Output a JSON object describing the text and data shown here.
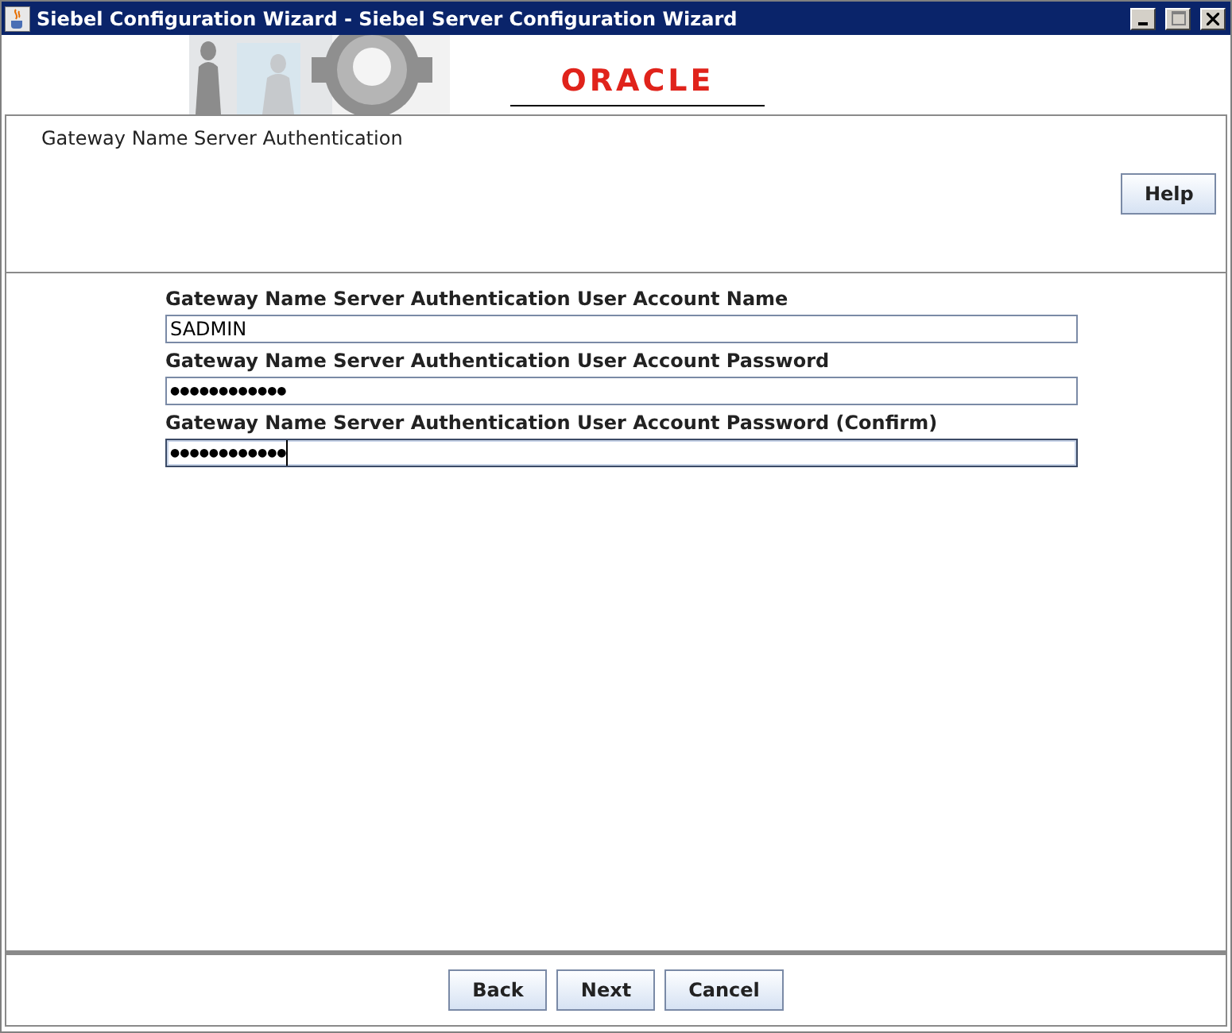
{
  "window": {
    "title": "Siebel Configuration Wizard - Siebel Server Configuration Wizard"
  },
  "banner": {
    "logo": "ORACLE",
    "kind": "picture"
  },
  "header": {
    "title": "Gateway Name Server Authentication",
    "help_button": "Help"
  },
  "fields": [
    {
      "label": "Gateway Name Server Authentication User Account Name",
      "value": "SADMIN",
      "focused": false
    },
    {
      "label": "Gateway Name Server Authentication User Account Password",
      "value": "●●●●●●●●●●●●",
      "focused": false
    },
    {
      "label": "Gateway Name Server Authentication User Account Password (Confirm)",
      "value": "●●●●●●●●●●●●",
      "focused": true
    }
  ],
  "buttons": [
    "Back",
    "Next",
    "Cancel"
  ]
}
